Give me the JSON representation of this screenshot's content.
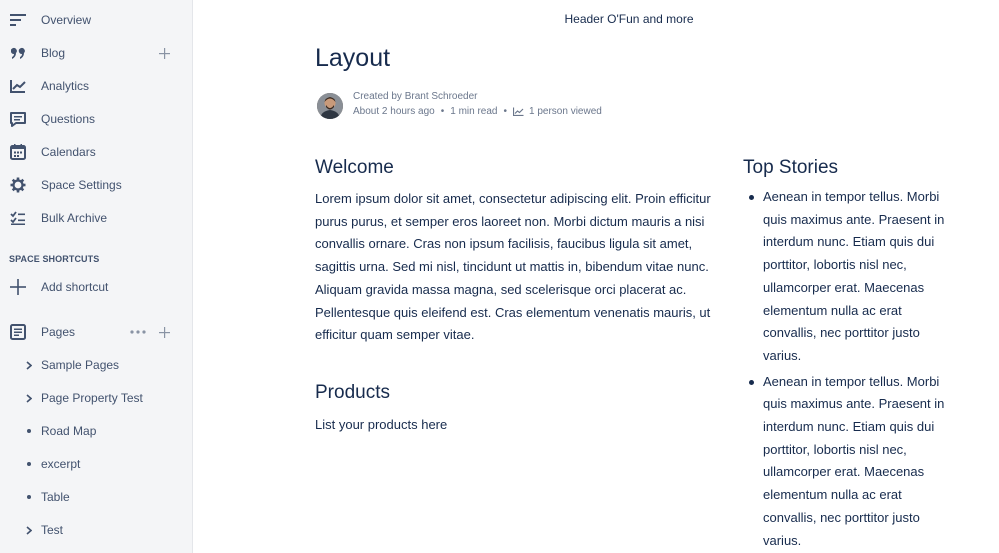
{
  "sidebar": {
    "nav": [
      {
        "label": "Overview",
        "icon": "overview-icon"
      },
      {
        "label": "Blog",
        "icon": "quote-icon"
      },
      {
        "label": "Analytics",
        "icon": "analytics-icon"
      },
      {
        "label": "Questions",
        "icon": "questions-icon"
      },
      {
        "label": "Calendars",
        "icon": "calendar-icon"
      },
      {
        "label": "Space Settings",
        "icon": "gear-icon"
      },
      {
        "label": "Bulk Archive",
        "icon": "archive-checklist-icon"
      }
    ],
    "shortcuts_heading": "SPACE SHORTCUTS",
    "add_shortcut": "Add shortcut",
    "pages_label": "Pages",
    "page_tree": [
      {
        "label": "Sample Pages",
        "marker": "chevron"
      },
      {
        "label": "Page Property Test",
        "marker": "chevron"
      },
      {
        "label": "Road Map",
        "marker": "dot"
      },
      {
        "label": "excerpt",
        "marker": "dot"
      },
      {
        "label": "Table",
        "marker": "dot"
      },
      {
        "label": "Test",
        "marker": "chevron"
      }
    ]
  },
  "main": {
    "header_link": "Header O'Fun and more",
    "title": "Layout",
    "byline": "Created by Brant Schroeder",
    "meta": {
      "time": "About 2 hours ago",
      "read_time": "1 min read",
      "viewed": "1 person viewed"
    },
    "welcome": {
      "heading": "Welcome",
      "lines": [
        "Lorem ipsum dolor sit amet, consectetur adipiscing elit. Proin efficitur",
        "purus purus, et semper eros laoreet non. Morbi dictum mauris a nisi",
        "convallis ornare. Cras non ipsum facilisis, faucibus ligula sit amet,",
        "sagittis urna. Sed mi nisl, tincidunt ut mattis in, bibendum vitae nunc.",
        "Aliquam gravida massa magna, sed scelerisque orci placerat ac.",
        "Pellentesque quis eleifend est. Cras elementum venenatis mauris, ut",
        "efficitur quam semper vitae."
      ]
    },
    "products": {
      "heading": "Products",
      "text": "List your products here"
    },
    "top_stories": {
      "heading": "Top Stories",
      "items": [
        [
          "Aenean in tempor tellus. Morbi",
          "quis maximus ante. Praesent in",
          "interdum nunc. Etiam quis dui",
          "porttitor, lobortis nisl nec,",
          "ullamcorper erat. Maecenas",
          "elementum nulla ac erat",
          "convallis, nec porttitor justo",
          "varius."
        ],
        [
          "Aenean in tempor tellus. Morbi",
          "quis maximus ante. Praesent in",
          "interdum nunc. Etiam quis dui",
          "porttitor, lobortis nisl nec,",
          "ullamcorper erat. Maecenas",
          "elementum nulla ac erat",
          "convallis, nec porttitor justo",
          "varius."
        ]
      ]
    }
  }
}
